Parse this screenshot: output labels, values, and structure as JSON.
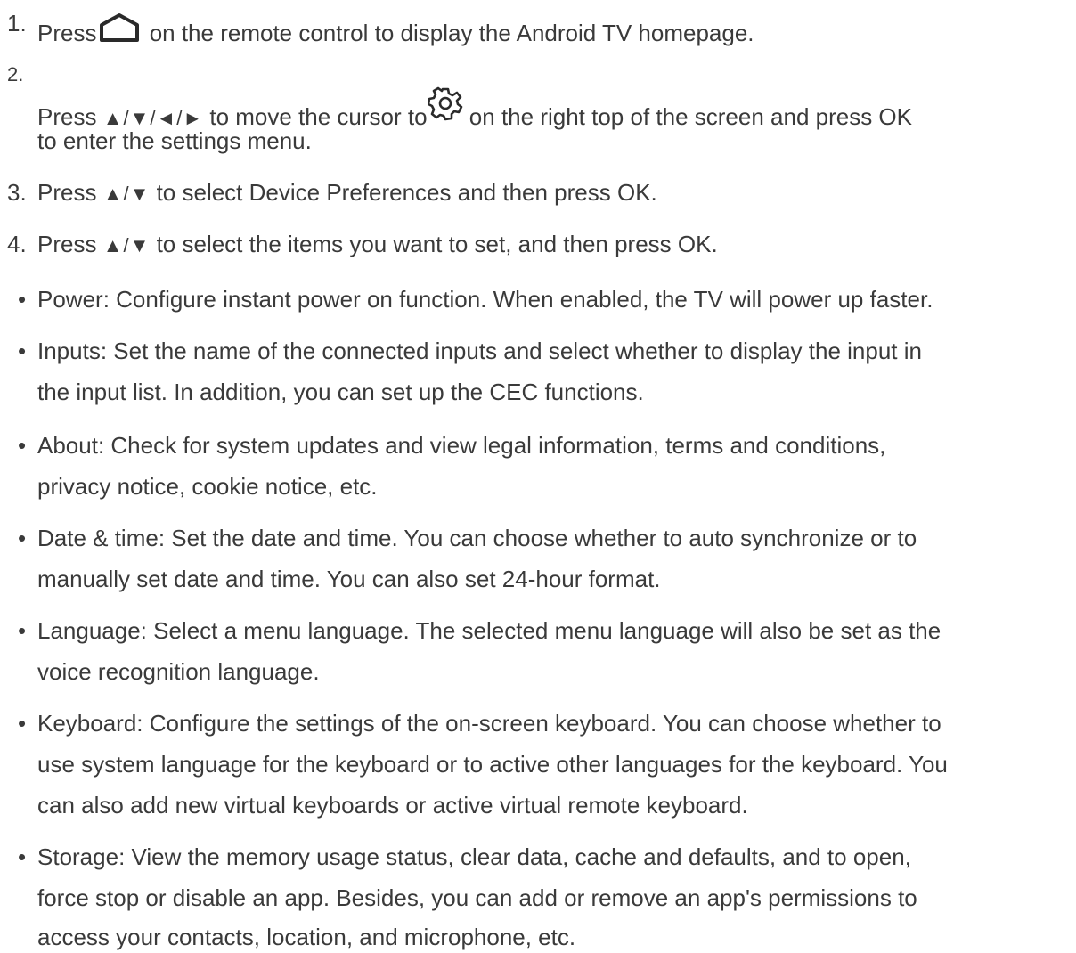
{
  "steps": [
    {
      "number": "1.",
      "before": "Press",
      "icon": "home-icon",
      "after": " on the remote control to display the Android TV homepage."
    },
    {
      "number": "2.",
      "before": "Press ",
      "arrows": "▲/▼/◄/►",
      "middle": " to move the cursor to",
      "icon": "gear-icon",
      "after": " on the right top of the screen and press OK",
      "continuation": "to enter the settings menu."
    },
    {
      "number": "3.",
      "before": "Press ",
      "arrows": "▲/▼",
      "after": " to select Device Preferences and then press OK."
    },
    {
      "number": "4.",
      "before": "Press ",
      "arrows": "▲/▼",
      "after": " to select the items you want to set, and then press OK."
    }
  ],
  "bullet_char": "•",
  "items": [
    {
      "lines": [
        "Power: Configure instant power on function. When enabled, the TV will power up faster."
      ]
    },
    {
      "lines": [
        "Inputs: Set the name of the connected inputs and select whether to display the input in",
        "the input list. In addition, you can set up the CEC functions."
      ]
    },
    {
      "lines": [
        "About: Check for system updates and view legal information, terms and conditions,",
        "privacy notice, cookie notice, etc."
      ]
    },
    {
      "lines": [
        "Date & time: Set the date and time. You can choose whether to auto synchronize or to",
        "manually set date and time. You can also set 24-hour format."
      ]
    },
    {
      "lines": [
        "Language: Select a menu language. The selected menu language will also be set as the",
        "voice recognition language."
      ]
    },
    {
      "lines": [
        "Keyboard: Configure the settings of the on-screen keyboard. You can choose whether to",
        "use system language for the keyboard or to active other languages for the keyboard. You",
        "can also add new virtual keyboards or active virtual remote keyboard."
      ]
    },
    {
      "lines": [
        "Storage: View the memory usage status, clear data, cache and defaults, and to open,",
        "force stop or disable an app. Besides, you can add or remove an app's permissions to",
        "access your contacts, location, and microphone, etc."
      ]
    }
  ]
}
